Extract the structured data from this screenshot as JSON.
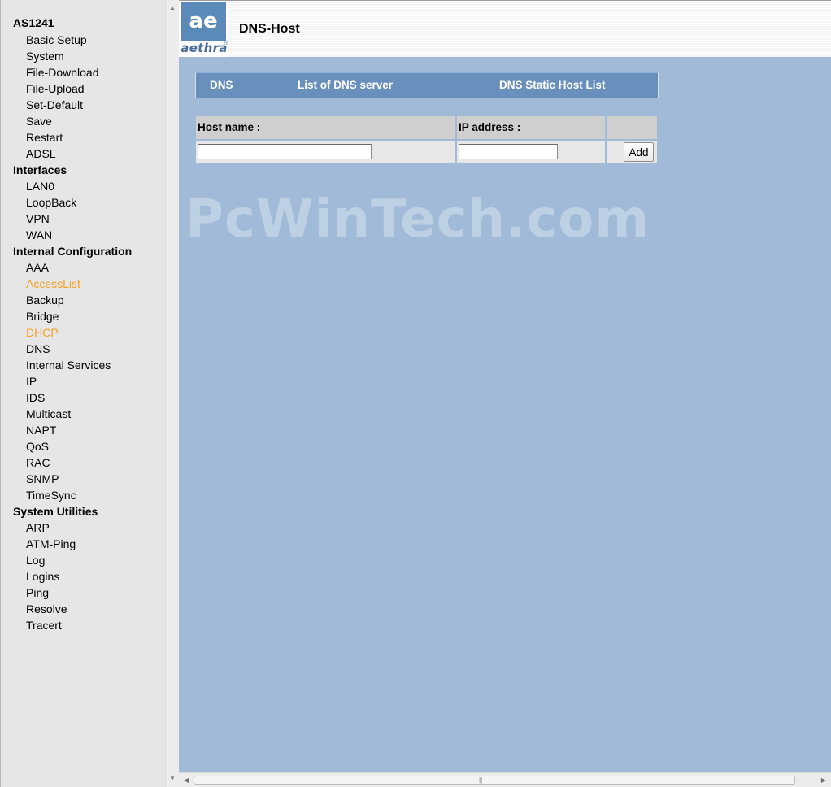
{
  "nav": {
    "root": "AS1241",
    "items": [
      {
        "label": "Basic Setup",
        "type": "item"
      },
      {
        "label": "System",
        "type": "item"
      },
      {
        "label": "File-Download",
        "type": "item"
      },
      {
        "label": "File-Upload",
        "type": "item"
      },
      {
        "label": "Set-Default",
        "type": "item"
      },
      {
        "label": "Save",
        "type": "item"
      },
      {
        "label": "Restart",
        "type": "item"
      },
      {
        "label": "ADSL",
        "type": "item"
      },
      {
        "label": "Interfaces",
        "type": "group"
      },
      {
        "label": "LAN0",
        "type": "item"
      },
      {
        "label": "LoopBack",
        "type": "item"
      },
      {
        "label": "VPN",
        "type": "item"
      },
      {
        "label": "WAN",
        "type": "item"
      },
      {
        "label": "Internal Configuration",
        "type": "group"
      },
      {
        "label": "AAA",
        "type": "item"
      },
      {
        "label": "AccessList",
        "type": "item",
        "active": true
      },
      {
        "label": "Backup",
        "type": "item"
      },
      {
        "label": "Bridge",
        "type": "item"
      },
      {
        "label": "DHCP",
        "type": "item",
        "active": true
      },
      {
        "label": "DNS",
        "type": "item"
      },
      {
        "label": "Internal Services",
        "type": "item"
      },
      {
        "label": "IP",
        "type": "item"
      },
      {
        "label": "IDS",
        "type": "item"
      },
      {
        "label": "Multicast",
        "type": "item"
      },
      {
        "label": "NAPT",
        "type": "item"
      },
      {
        "label": "QoS",
        "type": "item"
      },
      {
        "label": "RAC",
        "type": "item"
      },
      {
        "label": "SNMP",
        "type": "item"
      },
      {
        "label": "TimeSync",
        "type": "item"
      },
      {
        "label": "System Utilities",
        "type": "group"
      },
      {
        "label": "ARP",
        "type": "item"
      },
      {
        "label": "ATM-Ping",
        "type": "item"
      },
      {
        "label": "Log",
        "type": "item"
      },
      {
        "label": "Logins",
        "type": "item"
      },
      {
        "label": "Ping",
        "type": "item"
      },
      {
        "label": "Resolve",
        "type": "item"
      },
      {
        "label": "Tracert",
        "type": "item"
      }
    ]
  },
  "header": {
    "logo_mark": "ae",
    "logo_word": "aethra",
    "logo_reg": "®",
    "title": "DNS-Host"
  },
  "tabs": {
    "dns": "DNS",
    "dns_server_list": "List of DNS server",
    "static_host_list": "DNS Static Host List"
  },
  "watermark": "PcWinTech.com",
  "form": {
    "host_name_label": "Host name :",
    "ip_address_label": "IP address :",
    "host_name_value": "",
    "ip_address_value": "",
    "add_button": "Add"
  },
  "colors": {
    "nav_active": "#f4a024",
    "content_bg": "#a0bad7",
    "tabbar_bg": "#6990bd"
  },
  "scrollbars": {
    "up_arrow": "▲",
    "down_arrow": "▼",
    "left_arrow": "◀",
    "right_arrow": "▶",
    "grip": "|||"
  }
}
